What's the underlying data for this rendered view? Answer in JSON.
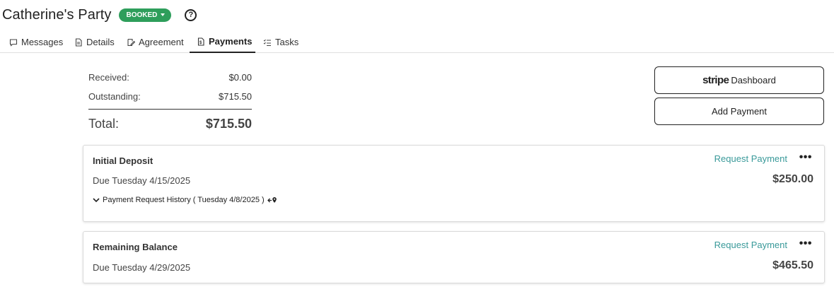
{
  "header": {
    "title": "Catherine's Party",
    "status": "BOOKED",
    "help": "?"
  },
  "tabs": [
    {
      "label": "Messages",
      "icon": "message-icon"
    },
    {
      "label": "Details",
      "icon": "document-icon"
    },
    {
      "label": "Agreement",
      "icon": "signature-icon"
    },
    {
      "label": "Payments",
      "icon": "invoice-icon",
      "active": true
    },
    {
      "label": "Tasks",
      "icon": "checklist-icon"
    }
  ],
  "summary": {
    "received_label": "Received:",
    "received_value": "$0.00",
    "outstanding_label": "Outstanding:",
    "outstanding_value": "$715.50",
    "total_label": "Total:",
    "total_value": "$715.50"
  },
  "actions": {
    "stripe_logo": "stripe",
    "stripe_label": "Dashboard",
    "add_payment": "Add Payment"
  },
  "payments": [
    {
      "title": "Initial Deposit",
      "due": "Due Tuesday 4/15/2025",
      "request": "Request Payment",
      "amount": "$250.00",
      "history": "Payment Request History ( Tuesday 4/8/2025 )"
    },
    {
      "title": "Remaining Balance",
      "due": "Due Tuesday 4/29/2025",
      "request": "Request Payment",
      "amount": "$465.50"
    }
  ],
  "colors": {
    "badge": "#2e9e5b",
    "link": "#3a9a9a"
  }
}
